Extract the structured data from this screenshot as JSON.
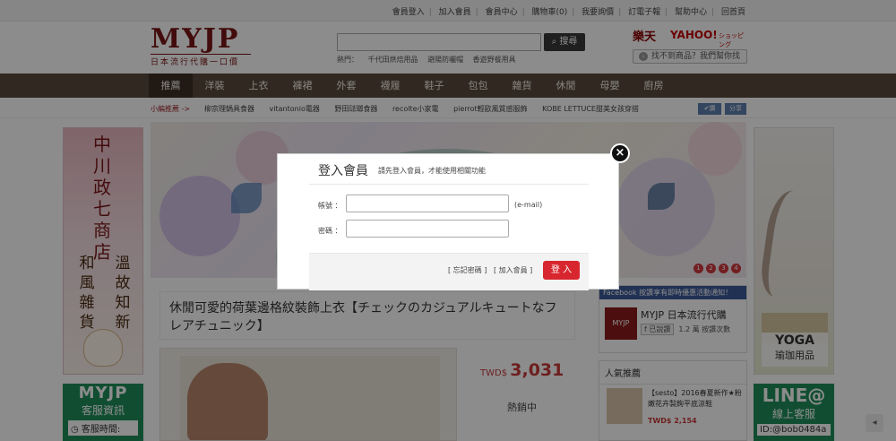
{
  "topbar": {
    "links": [
      "會員登入",
      "加入會員",
      "會員中心",
      "購物車(0)",
      "我要詢價",
      "訂電子報",
      "幫助中心",
      "回首頁"
    ]
  },
  "logo": {
    "main": "MYJP",
    "sub": "日本流行代購一口價"
  },
  "search": {
    "button": "搜尋",
    "hot_label": "熱門：",
    "hot_items": [
      "千代田烘焙用品",
      "避陽防曬帽",
      "香遊野餐用具"
    ]
  },
  "partners": {
    "rakuten": "樂天",
    "yahoo": "YAHOO!",
    "yahoo_suffix": "ショッピング",
    "find_button": "找不到商品？我們幫你找"
  },
  "nav": {
    "items": [
      "推薦",
      "洋裝",
      "上衣",
      "褲裙",
      "外套",
      "襪履",
      "鞋子",
      "包包",
      "雜貨",
      "休閒",
      "母嬰",
      "廚房"
    ]
  },
  "subnav": {
    "label": "小編推薦 ->",
    "links": [
      "柳宗理鍋具食器",
      "vitantonio電器",
      "野田琺瑯食器",
      "recolte小家電",
      "pierrot輕歐風質感服飾",
      "KOBE LETTUCE甜美女孩穿搭"
    ],
    "share_fb": "✔讚",
    "share": "分享"
  },
  "left_banner": {
    "line1": "中川政七商店",
    "line2": [
      "溫",
      "和",
      "故",
      "風",
      "知",
      "雜",
      "新",
      "貨"
    ]
  },
  "left_cs": {
    "title": "MYJP",
    "subtitle": "客服資訊",
    "row": "客服時間:"
  },
  "hero": {
    "dots": [
      "1",
      "2",
      "3",
      "4"
    ]
  },
  "product": {
    "title": "休閒可愛的荷葉邊格紋裝飾上衣【チェックのカジュアルキュートなフレアチュニック】",
    "price_prefix": "TWD$",
    "price": "3,031",
    "status": "熱銷中"
  },
  "facebook": {
    "header": "Facebook 按讚享有即時優惠活動通知！",
    "avatar": "MYJP",
    "name": "MYJP 日本流行代購",
    "liked": "已說讚",
    "count": "1.2 萬 按讚次數"
  },
  "popular": {
    "title": "人氣推薦",
    "item_desc": "【sesto】2016春夏新作★粉嫩花卉製鉤平底涼鞋",
    "item_price": "TWD$ 2,154"
  },
  "yoga": {
    "title": "YOGA",
    "subtitle": "瑜珈用品"
  },
  "line": {
    "title": "LINE@",
    "subtitle": "線上客服",
    "id": "ID:@bob0484a"
  },
  "modal": {
    "title": "登入會員",
    "subtitle": "請先登入會員，才能使用相關功能",
    "account_label": "帳號 ：",
    "password_label": "密碼 ：",
    "account_hint": "(e-mail)",
    "forgot": "[ 忘記密碼 ]",
    "join": "[ 加入會員 ]",
    "login": "登 入"
  },
  "colors": {
    "nav_bg": "#5a4a3d",
    "brand_red": "#7b1717",
    "button_red": "#d8262e",
    "line_green": "#1f8f5a",
    "fb_blue": "#3b5998"
  }
}
